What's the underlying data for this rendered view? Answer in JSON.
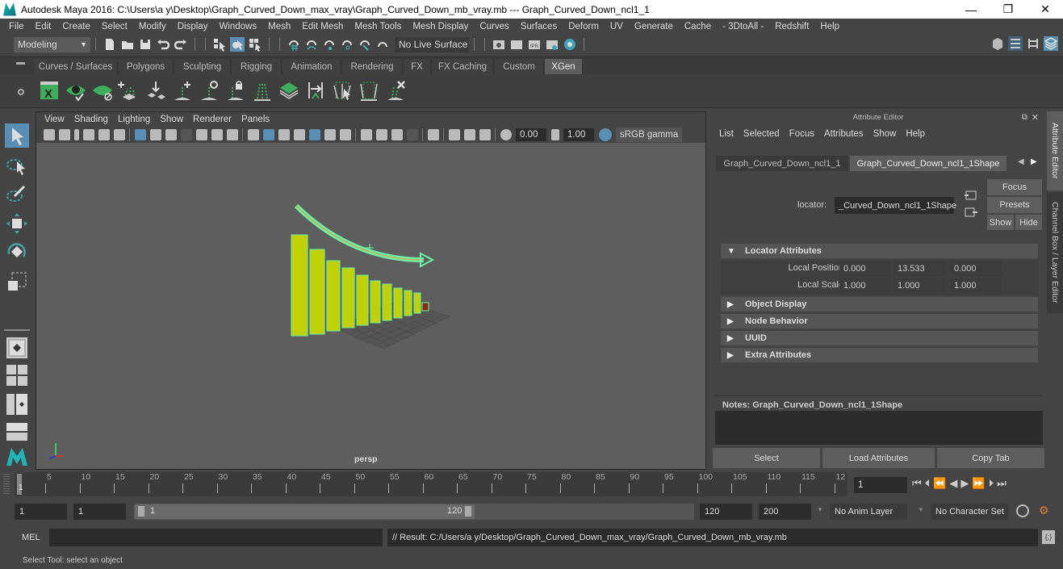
{
  "window": {
    "title": "Autodesk Maya 2016: C:\\Users\\a y\\Desktop\\Graph_Curved_Down_max_vray\\Graph_Curved_Down_mb_vray.mb   ---   Graph_Curved_Down_ncl1_1",
    "minimize": "—",
    "maximize": "❐",
    "close": "✕"
  },
  "menubar": [
    "File",
    "Edit",
    "Create",
    "Select",
    "Modify",
    "Display",
    "Windows",
    "Mesh",
    "Edit Mesh",
    "Mesh Tools",
    "Mesh Display",
    "Curves",
    "Surfaces",
    "Deform",
    "UV",
    "Generate",
    "Cache",
    "- 3DtoAll -",
    "Redshift",
    "Help"
  ],
  "statusline": {
    "mode": "Modeling",
    "live_surface": "No Live Surface"
  },
  "shelf": {
    "tabs": [
      "Curves / Surfaces",
      "Polygons",
      "Sculpting",
      "Rigging",
      "Animation",
      "Rendering",
      "FX",
      "FX Caching",
      "Custom",
      "XGen"
    ],
    "active_tab": "XGen",
    "icons": [
      "xgen-editor-icon",
      "create-description-icon",
      "delete-description-icon",
      "add-guides-icon",
      "place-guide-icon",
      "add-guide-icon",
      "select-guide-icon",
      "lock-guide-icon",
      "sculpt-guides-icon",
      "patch-icon",
      "attach-guide-icon",
      "groom-select-icon",
      "groom-icon",
      "delete-guides-icon"
    ]
  },
  "viewport": {
    "menu": [
      "View",
      "Shading",
      "Lighting",
      "Show",
      "Renderer",
      "Panels"
    ],
    "exposure": "0.00",
    "gamma": "1.00",
    "color_space": "sRGB gamma",
    "camera_label": "persp",
    "axis": {
      "x": "x",
      "y": "y",
      "z": "z"
    }
  },
  "attribute_editor": {
    "title": "Attribute Editor",
    "menu": [
      "List",
      "Selected",
      "Focus",
      "Attributes",
      "Show",
      "Help"
    ],
    "tabs": [
      "Graph_Curved_Down_ncl1_1",
      "Graph_Curved_Down_ncl1_1Shape"
    ],
    "active_tab": "Graph_Curved_Down_ncl1_1Shape",
    "node_label": "locator:",
    "node_value": "_Curved_Down_ncl1_1Shape",
    "buttons": {
      "focus": "Focus",
      "presets": "Presets",
      "show": "Show",
      "hide": "Hide"
    },
    "sections": [
      {
        "label": "Locator Attributes",
        "expanded": true
      },
      {
        "label": "Object Display",
        "expanded": false
      },
      {
        "label": "Node Behavior",
        "expanded": false
      },
      {
        "label": "UUID",
        "expanded": false
      },
      {
        "label": "Extra Attributes",
        "expanded": false
      }
    ],
    "attributes": [
      {
        "label": "Local Position",
        "values": [
          "0.000",
          "13.533",
          "0.000"
        ]
      },
      {
        "label": "Local Scale",
        "values": [
          "1.000",
          "1.000",
          "1.000"
        ]
      }
    ],
    "notes_label": "Notes:  Graph_Curved_Down_ncl1_1Shape",
    "bottom_buttons": [
      "Select",
      "Load Attributes",
      "Copy Tab"
    ],
    "side_tabs": [
      "Attribute Editor",
      "Channel Box / Layer Editor"
    ]
  },
  "timeline": {
    "ticks": [
      "5",
      "10",
      "15",
      "20",
      "25",
      "30",
      "35",
      "40",
      "45",
      "50",
      "55",
      "60",
      "65",
      "70",
      "75",
      "80",
      "85",
      "90",
      "95",
      "100",
      "105",
      "110",
      "115",
      "12"
    ],
    "current_frame_marker": "1",
    "current_frame": "1"
  },
  "range": {
    "start": "1",
    "playback_start": "1",
    "slider_start": "1",
    "slider_end": "120",
    "playback_end": "120",
    "end": "200",
    "anim_layer": "No Anim Layer",
    "character_set": "No Character Set"
  },
  "command": {
    "lang": "MEL",
    "result": "// Result: C:/Users/a y/Desktop/Graph_Curved_Down_max_vray/Graph_Curved_Down_mb_vray.mb"
  },
  "help_line": "Select Tool: select an object",
  "colors": {
    "accent": "#5a8fb5",
    "mesh_wire": "#5cf0a0",
    "mesh_fill": "#c8d400",
    "selected_tab": "#5d5d5d"
  }
}
